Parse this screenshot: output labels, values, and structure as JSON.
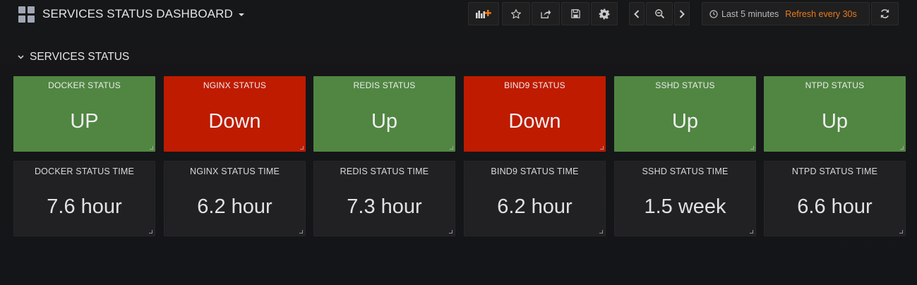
{
  "header": {
    "title": "SERVICES STATUS DASHBOARD",
    "time_range": "Last 5 minutes",
    "refresh": "Refresh every 30s"
  },
  "row": {
    "title": "SERVICES STATUS"
  },
  "colors": {
    "up": "#508642",
    "down": "#bf1b00",
    "refresh_text": "#eb7b18"
  },
  "status_panels": [
    {
      "title": "DOCKER STATUS",
      "value": "UP",
      "state": "up"
    },
    {
      "title": "NGINX STATUS",
      "value": "Down",
      "state": "down"
    },
    {
      "title": "REDIS STATUS",
      "value": "Up",
      "state": "up"
    },
    {
      "title": "BIND9 STATUS",
      "value": "Down",
      "state": "down"
    },
    {
      "title": "SSHD STATUS",
      "value": "Up",
      "state": "up"
    },
    {
      "title": "NTPD STATUS",
      "value": "Up",
      "state": "up"
    }
  ],
  "time_panels": [
    {
      "title": "DOCKER STATUS TIME",
      "value": "7.6 hour"
    },
    {
      "title": "NGINX STATUS TIME",
      "value": "6.2 hour"
    },
    {
      "title": "REDIS STATUS TIME",
      "value": "7.3 hour"
    },
    {
      "title": "BIND9 STATUS TIME",
      "value": "6.2 hour"
    },
    {
      "title": "SSHD STATUS TIME",
      "value": "1.5 week"
    },
    {
      "title": "NTPD STATUS TIME",
      "value": "6.6 hour"
    }
  ]
}
